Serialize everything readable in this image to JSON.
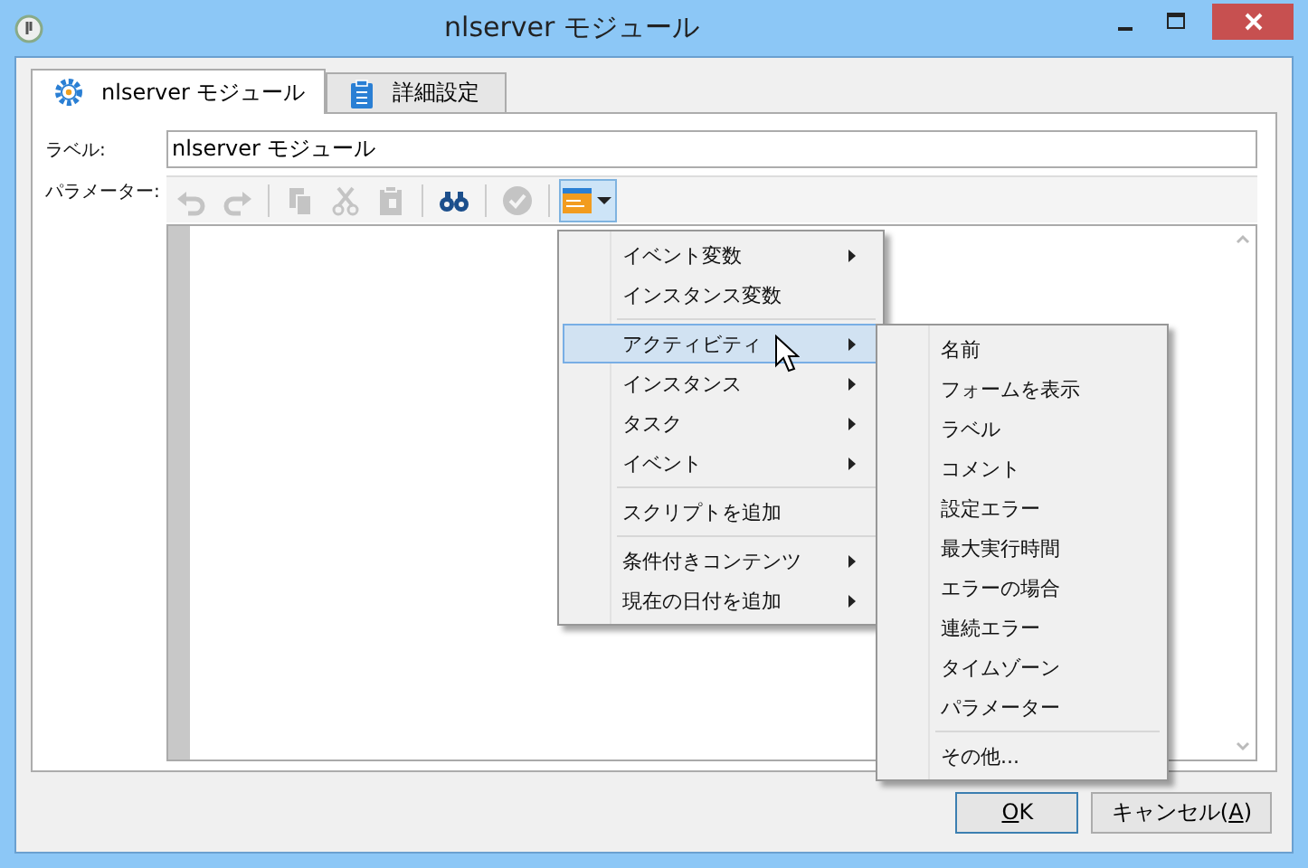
{
  "window": {
    "title": "nlserver モジュール"
  },
  "tabs": [
    {
      "label": "nlserver モジュール",
      "selected": true
    },
    {
      "label": "詳細設定",
      "selected": false
    }
  ],
  "label_field": {
    "label": "ラベル:",
    "value": "nlserver モジュール"
  },
  "parameters": {
    "label": "パラメーター:"
  },
  "toolbar": [
    {
      "kind": "undo",
      "disabled": true
    },
    {
      "kind": "redo",
      "disabled": true
    },
    {
      "kind": "sep"
    },
    {
      "kind": "copy",
      "disabled": true
    },
    {
      "kind": "cut",
      "disabled": true
    },
    {
      "kind": "paste",
      "disabled": true
    },
    {
      "kind": "sep"
    },
    {
      "kind": "find",
      "disabled": false
    },
    {
      "kind": "sep"
    },
    {
      "kind": "check",
      "disabled": true
    },
    {
      "kind": "sep"
    },
    {
      "kind": "insert",
      "disabled": false,
      "expanded": true
    }
  ],
  "menu": [
    [
      {
        "label": "イベント変数",
        "submenu": true,
        "selected": false
      },
      {
        "label": "インスタンス変数",
        "submenu": false,
        "selected": false
      }
    ],
    [
      {
        "label": "アクティビティ",
        "submenu": true,
        "selected": true
      },
      {
        "label": "インスタンス",
        "submenu": true,
        "selected": false
      },
      {
        "label": "タスク",
        "submenu": true,
        "selected": false
      },
      {
        "label": "イベント",
        "submenu": true,
        "selected": false
      }
    ],
    [
      {
        "label": "スクリプトを追加",
        "submenu": false,
        "selected": false
      }
    ],
    [
      {
        "label": "条件付きコンテンツ",
        "submenu": true,
        "selected": false
      },
      {
        "label": "現在の日付を追加",
        "submenu": true,
        "selected": false
      }
    ]
  ],
  "submenu": [
    [
      {
        "label": "名前"
      },
      {
        "label": "フォームを表示"
      },
      {
        "label": "ラベル"
      },
      {
        "label": "コメント"
      },
      {
        "label": "設定エラー"
      },
      {
        "label": "最大実行時間"
      },
      {
        "label": "エラーの場合"
      },
      {
        "label": "連続エラー"
      },
      {
        "label": "タイムゾーン"
      },
      {
        "label": "パラメーター"
      }
    ],
    [
      {
        "label": "その他..."
      }
    ]
  ],
  "buttons": [
    {
      "key": "O",
      "after": "K",
      "default": true
    },
    {
      "before": "キャンセル(",
      "key": "A",
      "after": ")",
      "default": false
    }
  ]
}
